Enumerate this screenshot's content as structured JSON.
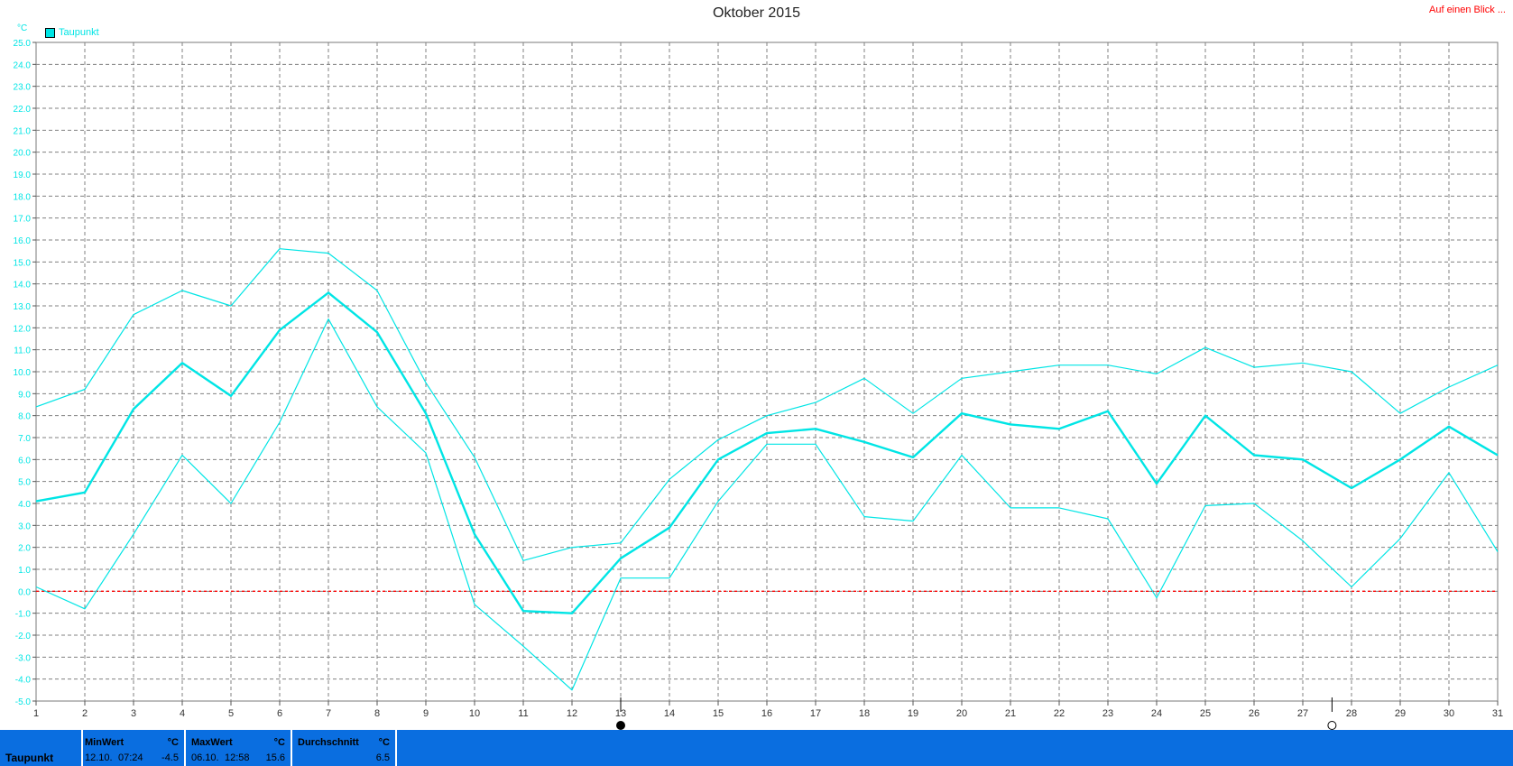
{
  "header": {
    "title": "Oktober 2015",
    "link_label": "Auf einen Blick ...",
    "unit_label": "°C",
    "legend_label": "Taupunkt"
  },
  "colors": {
    "series": "#00e5e5",
    "zero_line": "#ff0000",
    "grid": "#808080",
    "bar": "#0a6ee0"
  },
  "chart_data": {
    "type": "line",
    "title": "Oktober 2015",
    "xlabel": "",
    "ylabel": "°C",
    "x": [
      1,
      2,
      3,
      4,
      5,
      6,
      7,
      8,
      9,
      10,
      11,
      12,
      13,
      14,
      15,
      16,
      17,
      18,
      19,
      20,
      21,
      22,
      23,
      24,
      25,
      26,
      27,
      28,
      29,
      30,
      31
    ],
    "xlim": [
      1,
      31
    ],
    "ylim": [
      -5,
      25
    ],
    "ytick_step": 1,
    "grid": true,
    "legend": [
      "Taupunkt"
    ],
    "legend_position": "top-left",
    "markers": [
      {
        "x": 13,
        "symbol": "full-moon"
      },
      {
        "x": 27.6,
        "symbol": "new-moon"
      }
    ],
    "series": [
      {
        "name": "Taupunkt",
        "role": "average",
        "values": [
          4.1,
          4.5,
          8.3,
          10.4,
          8.9,
          11.9,
          13.6,
          11.8,
          8.1,
          2.6,
          -0.9,
          -1.0,
          1.5,
          2.9,
          6.0,
          7.2,
          7.4,
          6.8,
          6.1,
          8.1,
          7.6,
          7.4,
          8.2,
          4.9,
          8.0,
          6.2,
          6.0,
          4.7,
          6.0,
          7.5,
          6.2
        ]
      },
      {
        "name": "",
        "role": "max",
        "values": [
          8.4,
          9.2,
          12.6,
          13.7,
          13.0,
          15.6,
          15.4,
          13.7,
          9.5,
          6.1,
          1.4,
          2.0,
          2.2,
          5.1,
          6.9,
          8.0,
          8.6,
          9.7,
          8.1,
          9.7,
          10.0,
          10.3,
          10.3,
          9.9,
          11.1,
          10.2,
          10.4,
          10.0,
          8.1,
          9.3,
          10.3
        ]
      },
      {
        "name": "",
        "role": "min",
        "values": [
          0.2,
          -0.8,
          2.6,
          6.2,
          4.0,
          7.7,
          12.4,
          8.4,
          6.3,
          -0.6,
          -2.5,
          -4.5,
          0.6,
          0.6,
          4.1,
          6.7,
          6.7,
          3.4,
          3.2,
          6.2,
          3.8,
          3.8,
          3.3,
          -0.3,
          3.9,
          4.0,
          2.3,
          0.2,
          2.4,
          5.4,
          1.8
        ]
      }
    ]
  },
  "stats": {
    "row_label": "Taupunkt",
    "min": {
      "header": "MinWert",
      "unit": "°C",
      "date": "12.10.",
      "time": "07:24",
      "value": "-4.5"
    },
    "max": {
      "header": "MaxWert",
      "unit": "°C",
      "date": "06.10.",
      "time": "12:58",
      "value": "15.6"
    },
    "avg": {
      "header": "Durchschnitt",
      "unit": "°C",
      "value": "6.5"
    }
  }
}
